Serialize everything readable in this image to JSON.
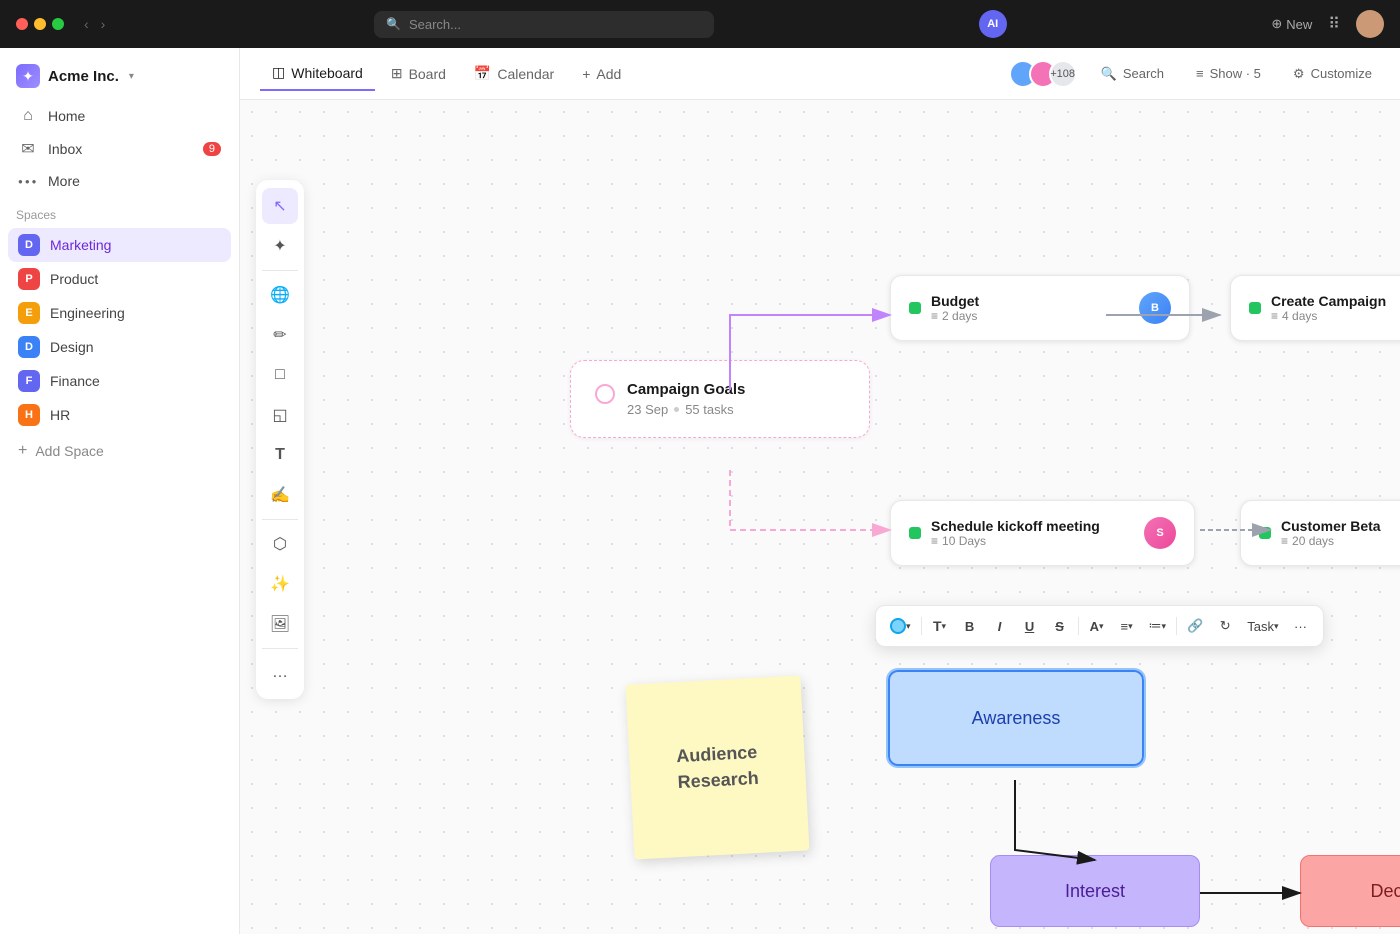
{
  "topbar": {
    "search_placeholder": "Search...",
    "ai_label": "AI",
    "new_label": "New"
  },
  "sidebar": {
    "logo": "Acme Inc.",
    "logo_chevron": "▾",
    "nav": [
      {
        "id": "home",
        "icon": "⌂",
        "label": "Home"
      },
      {
        "id": "inbox",
        "icon": "✉",
        "label": "Inbox",
        "badge": "9"
      },
      {
        "id": "more",
        "icon": "●●●",
        "label": "More"
      }
    ],
    "spaces_header": "Spaces",
    "spaces": [
      {
        "id": "marketing",
        "letter": "D",
        "label": "Marketing",
        "dot": "dot-d",
        "active": true
      },
      {
        "id": "product",
        "letter": "P",
        "label": "Product",
        "dot": "dot-p"
      },
      {
        "id": "engineering",
        "letter": "E",
        "label": "Engineering",
        "dot": "dot-e"
      },
      {
        "id": "design",
        "letter": "D",
        "label": "Design",
        "dot": "dot-d2"
      },
      {
        "id": "finance",
        "letter": "F",
        "label": "Finance",
        "dot": "dot-f"
      },
      {
        "id": "hr",
        "letter": "H",
        "label": "HR",
        "dot": "dot-h"
      }
    ],
    "add_space": "Add Space"
  },
  "tabs": [
    {
      "id": "whiteboard",
      "icon": "◫",
      "label": "Whiteboard",
      "active": true
    },
    {
      "id": "board",
      "icon": "⊞",
      "label": "Board"
    },
    {
      "id": "calendar",
      "icon": "📅",
      "label": "Calendar"
    },
    {
      "id": "add",
      "icon": "+",
      "label": "Add"
    }
  ],
  "tabbar_right": {
    "search": "Search",
    "show": "Show · 5",
    "customize": "Customize",
    "user_count": "+108"
  },
  "canvas": {
    "campaign_goals": {
      "title": "Campaign Goals",
      "date": "23 Sep",
      "tasks": "55 tasks"
    },
    "budget": {
      "title": "Budget",
      "days": "2 days"
    },
    "create_campaign": {
      "title": "Create Campaign",
      "days": "4 days"
    },
    "schedule_kickoff": {
      "title": "Schedule kickoff meeting",
      "days": "10 Days"
    },
    "customer_beta": {
      "title": "Customer Beta",
      "days": "20 days"
    },
    "sticky": {
      "line1": "Audience",
      "line2": "Research"
    },
    "awareness": "Awareness",
    "interest": "Interest",
    "decision": "Decision"
  },
  "tools": [
    {
      "id": "select",
      "icon": "↖",
      "active": true
    },
    {
      "id": "magic",
      "icon": "✦"
    },
    {
      "id": "globe",
      "icon": "🌐"
    },
    {
      "id": "pen",
      "icon": "✏️"
    },
    {
      "id": "rectangle",
      "icon": "□"
    },
    {
      "id": "note",
      "icon": "📄"
    },
    {
      "id": "text",
      "icon": "T"
    },
    {
      "id": "hand",
      "icon": "✍"
    },
    {
      "id": "network",
      "icon": "⬡"
    },
    {
      "id": "sparkle",
      "icon": "✨"
    },
    {
      "id": "image",
      "icon": "🖼"
    },
    {
      "id": "more",
      "icon": "…"
    }
  ],
  "text_toolbar": {
    "color_btn": "color",
    "font_btn": "T▾",
    "bold": "B",
    "italic": "I",
    "underline": "U",
    "strikethrough": "S",
    "text_size": "A▾",
    "align": "≡▾",
    "list": "≔▾",
    "link": "🔗",
    "refresh": "↻",
    "task_btn": "Task▾",
    "more_btn": "···"
  }
}
